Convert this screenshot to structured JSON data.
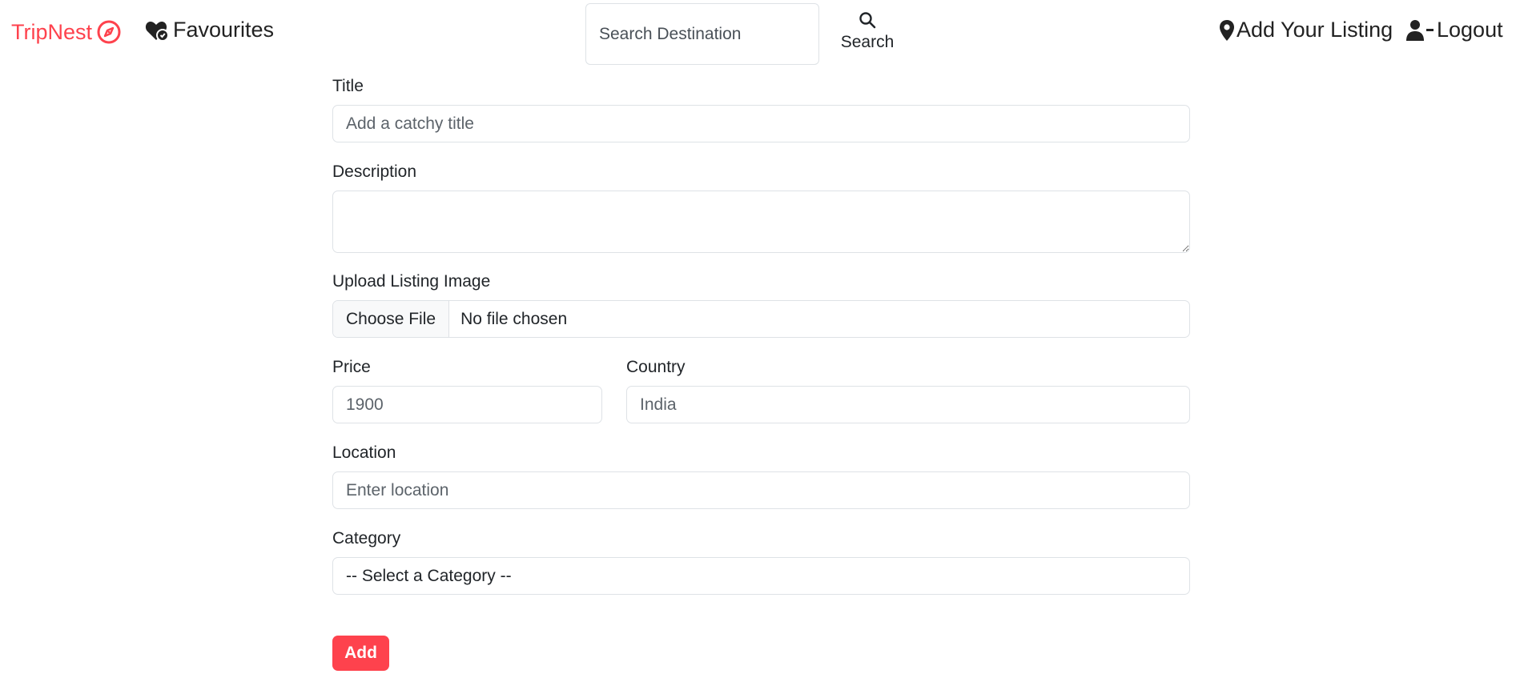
{
  "nav": {
    "brand": "TripNest",
    "favourites": "Favourites",
    "search_placeholder": "Search Destination",
    "search_label": "Search",
    "add_listing": "Add Your Listing",
    "logout": "Logout"
  },
  "form": {
    "title_label": "Title",
    "title_placeholder": "Add a catchy title",
    "description_label": "Description",
    "upload_label": "Upload Listing Image",
    "choose_file": "Choose File",
    "no_file": "No file chosen",
    "price_label": "Price",
    "price_placeholder": "1900",
    "country_label": "Country",
    "country_placeholder": "India",
    "location_label": "Location",
    "location_placeholder": "Enter location",
    "category_label": "Category",
    "category_selected": "-- Select a Category --",
    "submit": "Add"
  },
  "colors": {
    "brand": "#fe424d",
    "text": "#212529",
    "border": "#dee2e6"
  },
  "icons": [
    "compass-icon",
    "heart-badge-icon",
    "search-icon",
    "map-pin-icon",
    "user-minus-icon"
  ]
}
